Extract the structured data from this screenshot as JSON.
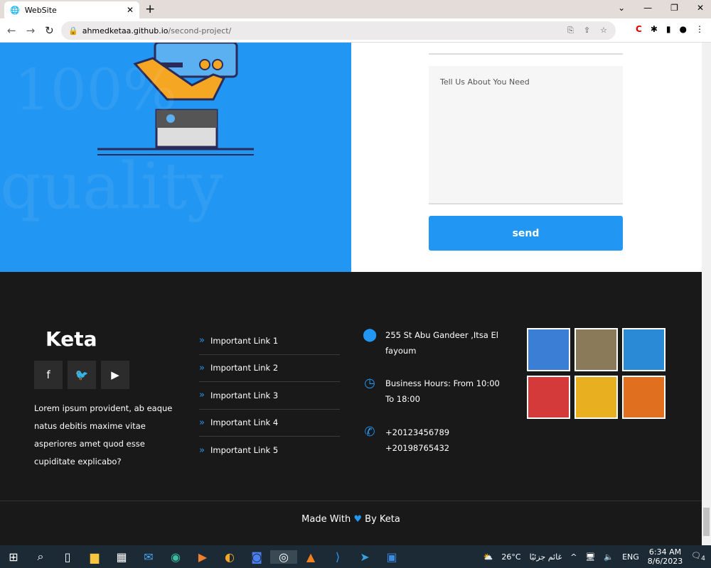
{
  "browser": {
    "tab_title": "WebSite",
    "url_host": "ahmedketaa.github.io",
    "url_path": "/second-project/"
  },
  "hero": {
    "watermark_1": "quality",
    "watermark_2": "100%"
  },
  "form": {
    "message_placeholder": "Tell Us About You Need",
    "send_label": "send"
  },
  "footer": {
    "logo": "Keta",
    "social": [
      {
        "icon": "facebook-icon",
        "glyph": "f"
      },
      {
        "icon": "twitter-icon",
        "glyph": "🐦"
      },
      {
        "icon": "youtube-icon",
        "glyph": "▶"
      }
    ],
    "about": "Lorem ipsum provident, ab eaque natus debitis maxime vitae asperiores amet quod esse cupiditate explicabo?",
    "links": [
      "Important Link 1",
      "Important Link 2",
      "Important Link 3",
      "Important Link 4",
      "Important Link 5"
    ],
    "address": "255 St Abu Gandeer ,Itsa El fayoum",
    "hours": "Business Hours: From 10:00 To 18:00",
    "phone1": "+20123456789",
    "phone2": "+20198765432",
    "copyright_pre": "Made With",
    "copyright_post": "By Keta",
    "gallery_colors": [
      "#3a7fd5",
      "#8a7a5a",
      "#2a8ad5",
      "#d53a3a",
      "#e8b020",
      "#e07020"
    ]
  },
  "taskbar": {
    "weather": "26°C",
    "weather_text": "غائم جزئيًا",
    "lang": "ENG",
    "time": "6:34 AM",
    "date": "8/6/2023",
    "notif": "4"
  }
}
